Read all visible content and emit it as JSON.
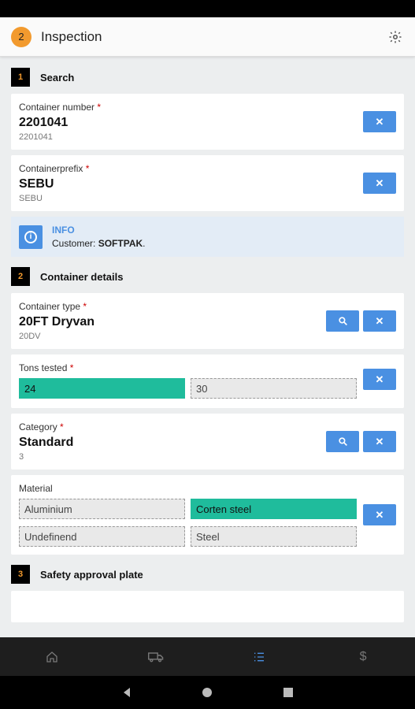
{
  "appbar": {
    "badge": "2",
    "title": "Inspection",
    "settings_icon": "gear-icon"
  },
  "sections": {
    "search": {
      "num": "1",
      "label": "Search"
    },
    "container_details": {
      "num": "2",
      "label": "Container details"
    },
    "safety": {
      "num": "3",
      "label": "Safety approval plate"
    }
  },
  "container_number": {
    "label": "Container number",
    "required": "*",
    "value": "2201041",
    "sub": "2201041"
  },
  "container_prefix": {
    "label": "Containerprefix",
    "required": "*",
    "value": "SEBU",
    "sub": "SEBU"
  },
  "info": {
    "heading": "INFO",
    "prefix": "Customer:",
    "customer": "SOFTPAK",
    "suffix": "."
  },
  "container_type": {
    "label": "Container type",
    "required": "*",
    "value": "20FT Dryvan",
    "sub": "20DV"
  },
  "tons_tested": {
    "label": "Tons tested",
    "required": "*",
    "options": [
      "24",
      "30"
    ],
    "selected": "24"
  },
  "category": {
    "label": "Category",
    "required": "*",
    "value": "Standard",
    "sub": "3"
  },
  "material": {
    "label": "Material",
    "options": [
      "Aluminium",
      "Corten steel",
      "Undefinend",
      "Steel"
    ],
    "selected": "Corten steel"
  },
  "buttons": {
    "clear": "✕",
    "search_icon": "search-icon"
  },
  "bottom_nav": [
    "home-icon",
    "truck-icon",
    "checklist-icon",
    "dollar-icon"
  ],
  "bottom_nav_active": "checklist-icon",
  "bottom_nav_glyphs": {
    "dollar": "$"
  },
  "colors": {
    "accent": "#4a90e2",
    "badge": "#f29a2e",
    "selected": "#1fbc9c",
    "required": "#cc0000"
  }
}
